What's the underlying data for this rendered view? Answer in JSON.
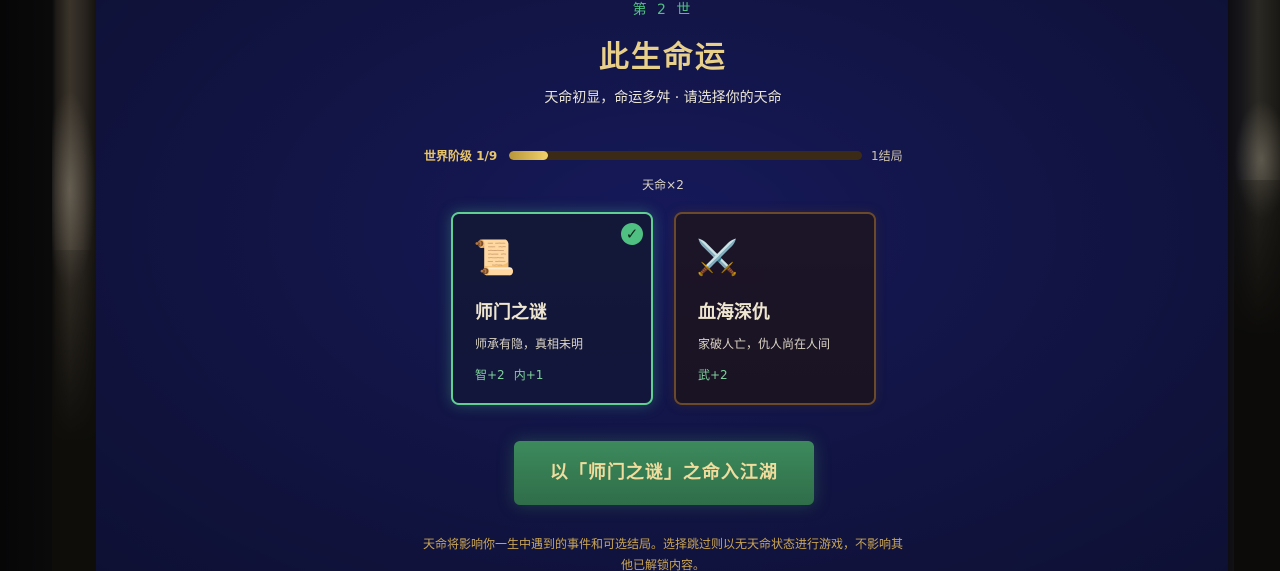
{
  "header": {
    "life_label": "第 2 世",
    "title": "此生命运",
    "subtitle": "天命初显，命运多舛 · 请选择你的天命"
  },
  "progress": {
    "label": "世界阶级 1/9",
    "fill_fraction": 0.111,
    "end_label": "1结局"
  },
  "fate_count": "天命×2",
  "cards": [
    {
      "icon": "scroll-icon",
      "icon_glyph": "📜",
      "name": "师门之谜",
      "description": "师承有隐，真相未明",
      "stats": [
        "智+2",
        "内+1"
      ],
      "selected": true
    },
    {
      "icon": "crossed-swords-icon",
      "icon_glyph": "⚔️",
      "name": "血海深仇",
      "description": "家破人亡，仇人尚在人间",
      "stats": [
        "武+2"
      ],
      "selected": false
    }
  ],
  "check_glyph": "✓",
  "enter_button": "以「师门之谜」之命入江湖",
  "footnote": "天命将影响你一生中遇到的事件和可选结局。选择跳过则以无天命状态进行游戏，不影响其他已解锁内容。",
  "colors": {
    "accent_gold": "#e8cf8a",
    "accent_green": "#4fbf82",
    "selected_border": "#5fcf92",
    "button_green": "#3d8a5d"
  }
}
